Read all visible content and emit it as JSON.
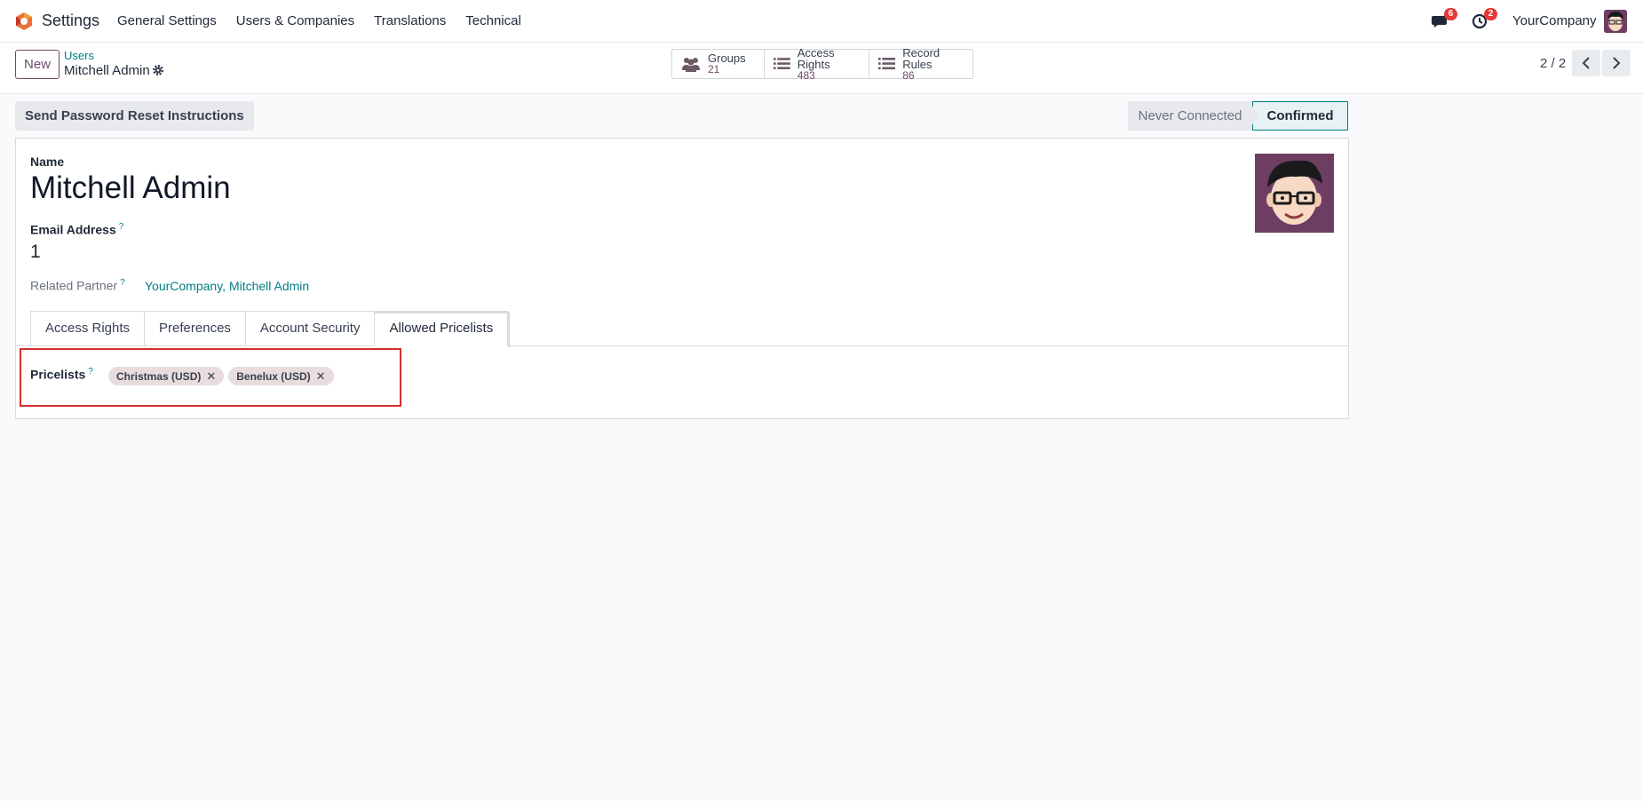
{
  "navbar": {
    "app_name": "Settings",
    "menu": [
      "General Settings",
      "Users & Companies",
      "Translations",
      "Technical"
    ],
    "messages_count": "6",
    "activities_count": "2",
    "company": "YourCompany"
  },
  "control": {
    "new_label": "New",
    "breadcrumb_parent": "Users",
    "breadcrumb_current": "Mitchell Admin",
    "smart_buttons": [
      {
        "label": "Groups",
        "value": "21",
        "icon": "users-icon"
      },
      {
        "label": "Access Rights",
        "value": "483",
        "icon": "list-icon"
      },
      {
        "label": "Record Rules",
        "value": "86",
        "icon": "list-icon"
      }
    ],
    "pager": "2 / 2"
  },
  "actions": {
    "reset_label": "Send Password Reset Instructions",
    "status_never": "Never Connected",
    "status_confirmed": "Confirmed"
  },
  "form": {
    "name_label": "Name",
    "name_value": "Mitchell Admin",
    "email_label": "Email Address",
    "email_value": "1",
    "partner_label": "Related Partner",
    "partner_value": "YourCompany, Mitchell Admin",
    "help_mark": "?",
    "tabs": [
      "Access Rights",
      "Preferences",
      "Account Security",
      "Allowed Pricelists"
    ],
    "active_tab": "Allowed Pricelists",
    "pricelists_label": "Pricelists",
    "pricelists": [
      "Christmas (USD)",
      "Benelux (USD)"
    ]
  }
}
